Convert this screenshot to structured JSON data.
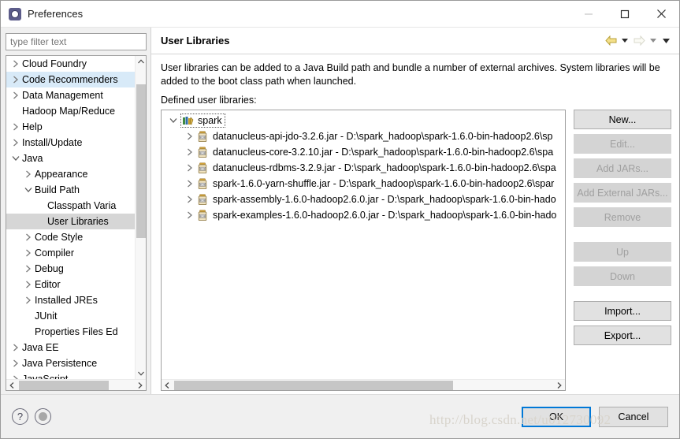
{
  "window": {
    "title": "Preferences",
    "icon": "preferences-gear-icon",
    "controls": {
      "minimize": "minimize-icon",
      "maximize": "maximize-icon",
      "close": "close-icon"
    }
  },
  "sidebar": {
    "filter": {
      "placeholder": "type filter text",
      "value": ""
    },
    "items": [
      {
        "label": "Cloud Foundry",
        "indent": 0,
        "twisty": "collapsed",
        "state": "normal"
      },
      {
        "label": "Code Recommenders",
        "indent": 0,
        "twisty": "collapsed",
        "state": "hover"
      },
      {
        "label": "Data Management",
        "indent": 0,
        "twisty": "collapsed",
        "state": "normal"
      },
      {
        "label": "Hadoop Map/Reduce",
        "indent": 0,
        "twisty": "none",
        "state": "normal"
      },
      {
        "label": "Help",
        "indent": 0,
        "twisty": "collapsed",
        "state": "normal"
      },
      {
        "label": "Install/Update",
        "indent": 0,
        "twisty": "collapsed",
        "state": "normal"
      },
      {
        "label": "Java",
        "indent": 0,
        "twisty": "expanded",
        "state": "normal"
      },
      {
        "label": "Appearance",
        "indent": 1,
        "twisty": "collapsed",
        "state": "normal"
      },
      {
        "label": "Build Path",
        "indent": 1,
        "twisty": "expanded",
        "state": "normal"
      },
      {
        "label": "Classpath Varia",
        "indent": 2,
        "twisty": "none",
        "state": "normal"
      },
      {
        "label": "User Libraries",
        "indent": 2,
        "twisty": "none",
        "state": "selected"
      },
      {
        "label": "Code Style",
        "indent": 1,
        "twisty": "collapsed",
        "state": "normal"
      },
      {
        "label": "Compiler",
        "indent": 1,
        "twisty": "collapsed",
        "state": "normal"
      },
      {
        "label": "Debug",
        "indent": 1,
        "twisty": "collapsed",
        "state": "normal"
      },
      {
        "label": "Editor",
        "indent": 1,
        "twisty": "collapsed",
        "state": "normal"
      },
      {
        "label": "Installed JREs",
        "indent": 1,
        "twisty": "collapsed",
        "state": "normal"
      },
      {
        "label": "JUnit",
        "indent": 1,
        "twisty": "none",
        "state": "normal"
      },
      {
        "label": "Properties Files Ed",
        "indent": 1,
        "twisty": "none",
        "state": "normal"
      },
      {
        "label": "Java EE",
        "indent": 0,
        "twisty": "collapsed",
        "state": "normal"
      },
      {
        "label": "Java Persistence",
        "indent": 0,
        "twisty": "collapsed",
        "state": "normal"
      },
      {
        "label": "JavaScript",
        "indent": 0,
        "twisty": "collapsed",
        "state": "normal"
      }
    ]
  },
  "page": {
    "title": "User Libraries",
    "nav": {
      "back": "back-arrow-icon",
      "back_dropdown": "chevron-down-icon",
      "forward": "forward-arrow-icon",
      "forward_dropdown": "chevron-down-icon",
      "menu_dropdown": "chevron-down-icon"
    },
    "description": "User libraries can be added to a Java Build path and bundle a number of external archives. System libraries will be added to the boot class path when launched.",
    "defined_label": "Defined user libraries:",
    "library_tree": [
      {
        "label": "spark",
        "type": "library",
        "icon": "library-icon",
        "twisty": "expanded",
        "level": 0,
        "focused": true
      },
      {
        "label": "datanucleus-api-jdo-3.2.6.jar - D:\\spark_hadoop\\spark-1.6.0-bin-hadoop2.6\\sp",
        "type": "jar",
        "icon": "jar-icon",
        "twisty": "collapsed",
        "level": 1,
        "focused": false
      },
      {
        "label": "datanucleus-core-3.2.10.jar - D:\\spark_hadoop\\spark-1.6.0-bin-hadoop2.6\\spa",
        "type": "jar",
        "icon": "jar-icon",
        "twisty": "collapsed",
        "level": 1,
        "focused": false
      },
      {
        "label": "datanucleus-rdbms-3.2.9.jar - D:\\spark_hadoop\\spark-1.6.0-bin-hadoop2.6\\spa",
        "type": "jar",
        "icon": "jar-icon",
        "twisty": "collapsed",
        "level": 1,
        "focused": false
      },
      {
        "label": "spark-1.6.0-yarn-shuffle.jar - D:\\spark_hadoop\\spark-1.6.0-bin-hadoop2.6\\spar",
        "type": "jar",
        "icon": "jar-icon",
        "twisty": "collapsed",
        "level": 1,
        "focused": false
      },
      {
        "label": "spark-assembly-1.6.0-hadoop2.6.0.jar - D:\\spark_hadoop\\spark-1.6.0-bin-hado",
        "type": "jar",
        "icon": "jar-icon",
        "twisty": "collapsed",
        "level": 1,
        "focused": false
      },
      {
        "label": "spark-examples-1.6.0-hadoop2.6.0.jar - D:\\spark_hadoop\\spark-1.6.0-bin-hado",
        "type": "jar",
        "icon": "jar-icon",
        "twisty": "collapsed",
        "level": 1,
        "focused": false
      }
    ],
    "buttons": [
      {
        "label": "New...",
        "enabled": true
      },
      {
        "label": "Edit...",
        "enabled": false
      },
      {
        "label": "Add JARs...",
        "enabled": false
      },
      {
        "label": "Add External JARs...",
        "enabled": false
      },
      {
        "label": "Remove",
        "enabled": false
      },
      {
        "label": "Up",
        "enabled": false
      },
      {
        "label": "Down",
        "enabled": false
      },
      {
        "label": "Import...",
        "enabled": true
      },
      {
        "label": "Export...",
        "enabled": true
      }
    ]
  },
  "footer": {
    "help_icon": "?",
    "secondary_icon": "restore-defaults-icon",
    "ok_label": "OK",
    "cancel_label": "Cancel",
    "watermark": "http://blog.csdn.net/u012730092"
  },
  "colors": {
    "accent": "#0078d7",
    "selection_blue": "#d8eaf8",
    "selection_gray": "#d6d6d6",
    "button_face": "#e1e1e1",
    "disabled_text": "#a0a0a0"
  }
}
